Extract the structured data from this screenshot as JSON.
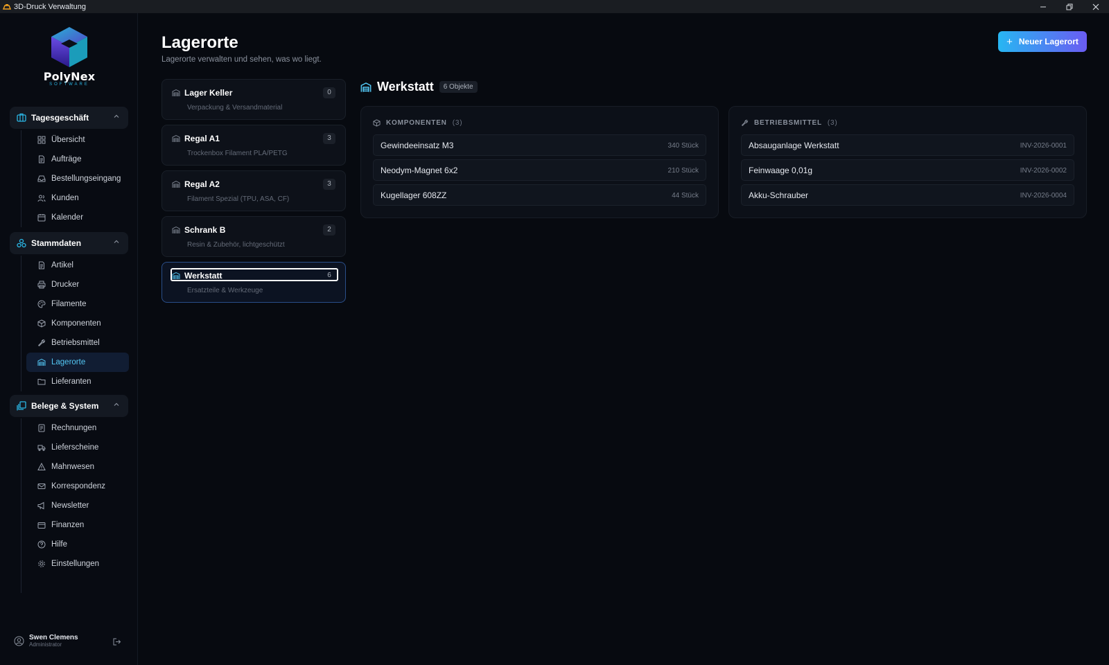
{
  "window": {
    "title": "3D-Druck Verwaltung"
  },
  "brand": {
    "name": "PolyNex",
    "tagline": "SOFTWARE"
  },
  "sidebar": {
    "groups": [
      {
        "label": "Tagesgeschäft",
        "items": [
          {
            "label": "Übersicht",
            "icon": "grid-icon"
          },
          {
            "label": "Aufträge",
            "icon": "document-icon"
          },
          {
            "label": "Bestellungseingang",
            "icon": "inbox-icon"
          },
          {
            "label": "Kunden",
            "icon": "users-icon"
          },
          {
            "label": "Kalender",
            "icon": "calendar-icon"
          }
        ]
      },
      {
        "label": "Stammdaten",
        "items": [
          {
            "label": "Artikel",
            "icon": "document-icon"
          },
          {
            "label": "Drucker",
            "icon": "printer-icon"
          },
          {
            "label": "Filamente",
            "icon": "palette-icon"
          },
          {
            "label": "Komponenten",
            "icon": "box-icon"
          },
          {
            "label": "Betriebsmittel",
            "icon": "wrench-icon"
          },
          {
            "label": "Lagerorte",
            "icon": "warehouse-icon",
            "active": true
          },
          {
            "label": "Lieferanten",
            "icon": "folder-icon"
          }
        ]
      },
      {
        "label": "Belege & System",
        "items": [
          {
            "label": "Rechnungen",
            "icon": "receipt-icon"
          },
          {
            "label": "Lieferscheine",
            "icon": "truck-icon"
          },
          {
            "label": "Mahnwesen",
            "icon": "warning-icon"
          },
          {
            "label": "Korrespondenz",
            "icon": "mail-icon"
          },
          {
            "label": "Newsletter",
            "icon": "megaphone-icon"
          },
          {
            "label": "Finanzen",
            "icon": "wallet-icon"
          },
          {
            "label": "Hilfe",
            "icon": "help-icon"
          },
          {
            "label": "Einstellungen",
            "icon": "gear-icon"
          }
        ]
      }
    ]
  },
  "user": {
    "name": "Swen Clemens",
    "role": "Administrator"
  },
  "page": {
    "title": "Lagerorte",
    "subtitle": "Lagerorte verwalten und sehen, was wo liegt.",
    "new_button": "Neuer Lagerort"
  },
  "locations": [
    {
      "name": "Lager Keller",
      "desc": "Verpackung & Versandmaterial",
      "count": "0"
    },
    {
      "name": "Regal A1",
      "desc": "Trockenbox Filament PLA/PETG",
      "count": "3"
    },
    {
      "name": "Regal A2",
      "desc": "Filament Spezial (TPU, ASA, CF)",
      "count": "3"
    },
    {
      "name": "Schrank B",
      "desc": "Resin & Zubehör, lichtgeschützt",
      "count": "2"
    },
    {
      "name": "Werkstatt",
      "desc": "Ersatzteile & Werkzeuge",
      "count": "6",
      "active": true
    }
  ],
  "detail": {
    "title": "Werkstatt",
    "badge": "6 Objekte",
    "components": {
      "header": "KOMPONENTEN",
      "count": "(3)",
      "rows": [
        {
          "name": "Gewindeeinsatz M3",
          "value": "340 Stück"
        },
        {
          "name": "Neodym-Magnet 6x2",
          "value": "210 Stück"
        },
        {
          "name": "Kugellager 608ZZ",
          "value": "44 Stück"
        }
      ]
    },
    "equipment": {
      "header": "BETRIEBSMITTEL",
      "count": "(3)",
      "rows": [
        {
          "name": "Absauganlage Werkstatt",
          "value": "INV-2026-0001"
        },
        {
          "name": "Feinwaage 0,01g",
          "value": "INV-2026-0002"
        },
        {
          "name": "Akku-Schrauber",
          "value": "INV-2026-0004"
        }
      ]
    }
  },
  "colors": {
    "accent": "#27b6f2",
    "accent2": "#6a5cf2",
    "background": "#070a10"
  }
}
